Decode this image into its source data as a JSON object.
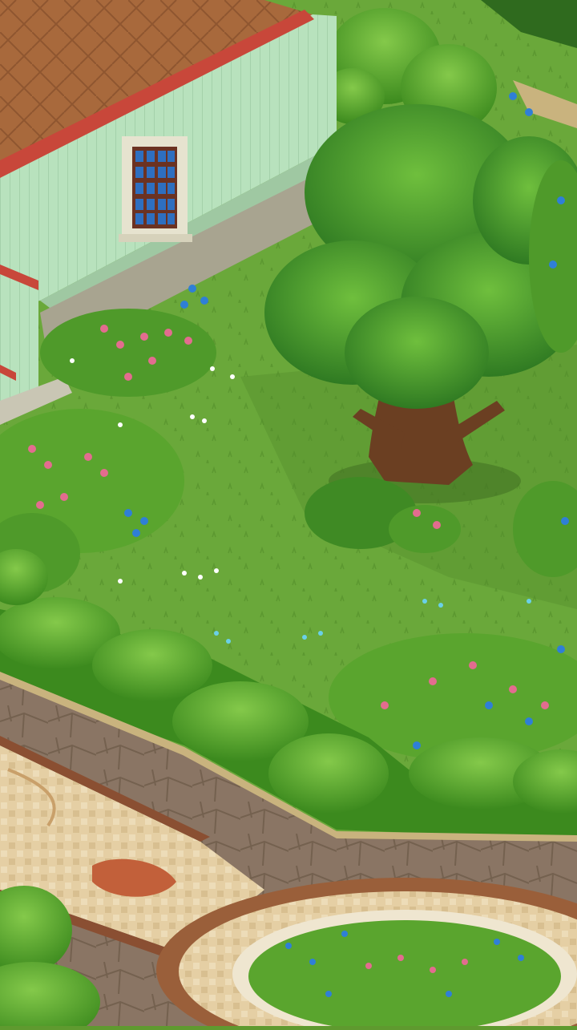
{
  "scene": {
    "title": "",
    "colors": {
      "lawn": "#6aa83a",
      "lawn_dark": "#4f8a2a",
      "hedge": "#4f9a22",
      "hedge_light": "#7cc23e",
      "house_wall": "#b8e2bd",
      "roof_floor": "#a8693c",
      "brick_trim": "#c8473a",
      "stone": "#a8a490",
      "path": "#8a7564",
      "mosaic": "#e5cfa4",
      "tree_trunk": "#6b3f22",
      "tree_leaf": "#3f8a2a",
      "flower_pink": "#e36c8f",
      "flower_blue": "#2f7fd6",
      "flower_white": "#ffffff"
    },
    "icons": [
      "house",
      "window",
      "tree",
      "hedge",
      "flower-bed",
      "mosaic-path",
      "round-planter"
    ]
  }
}
